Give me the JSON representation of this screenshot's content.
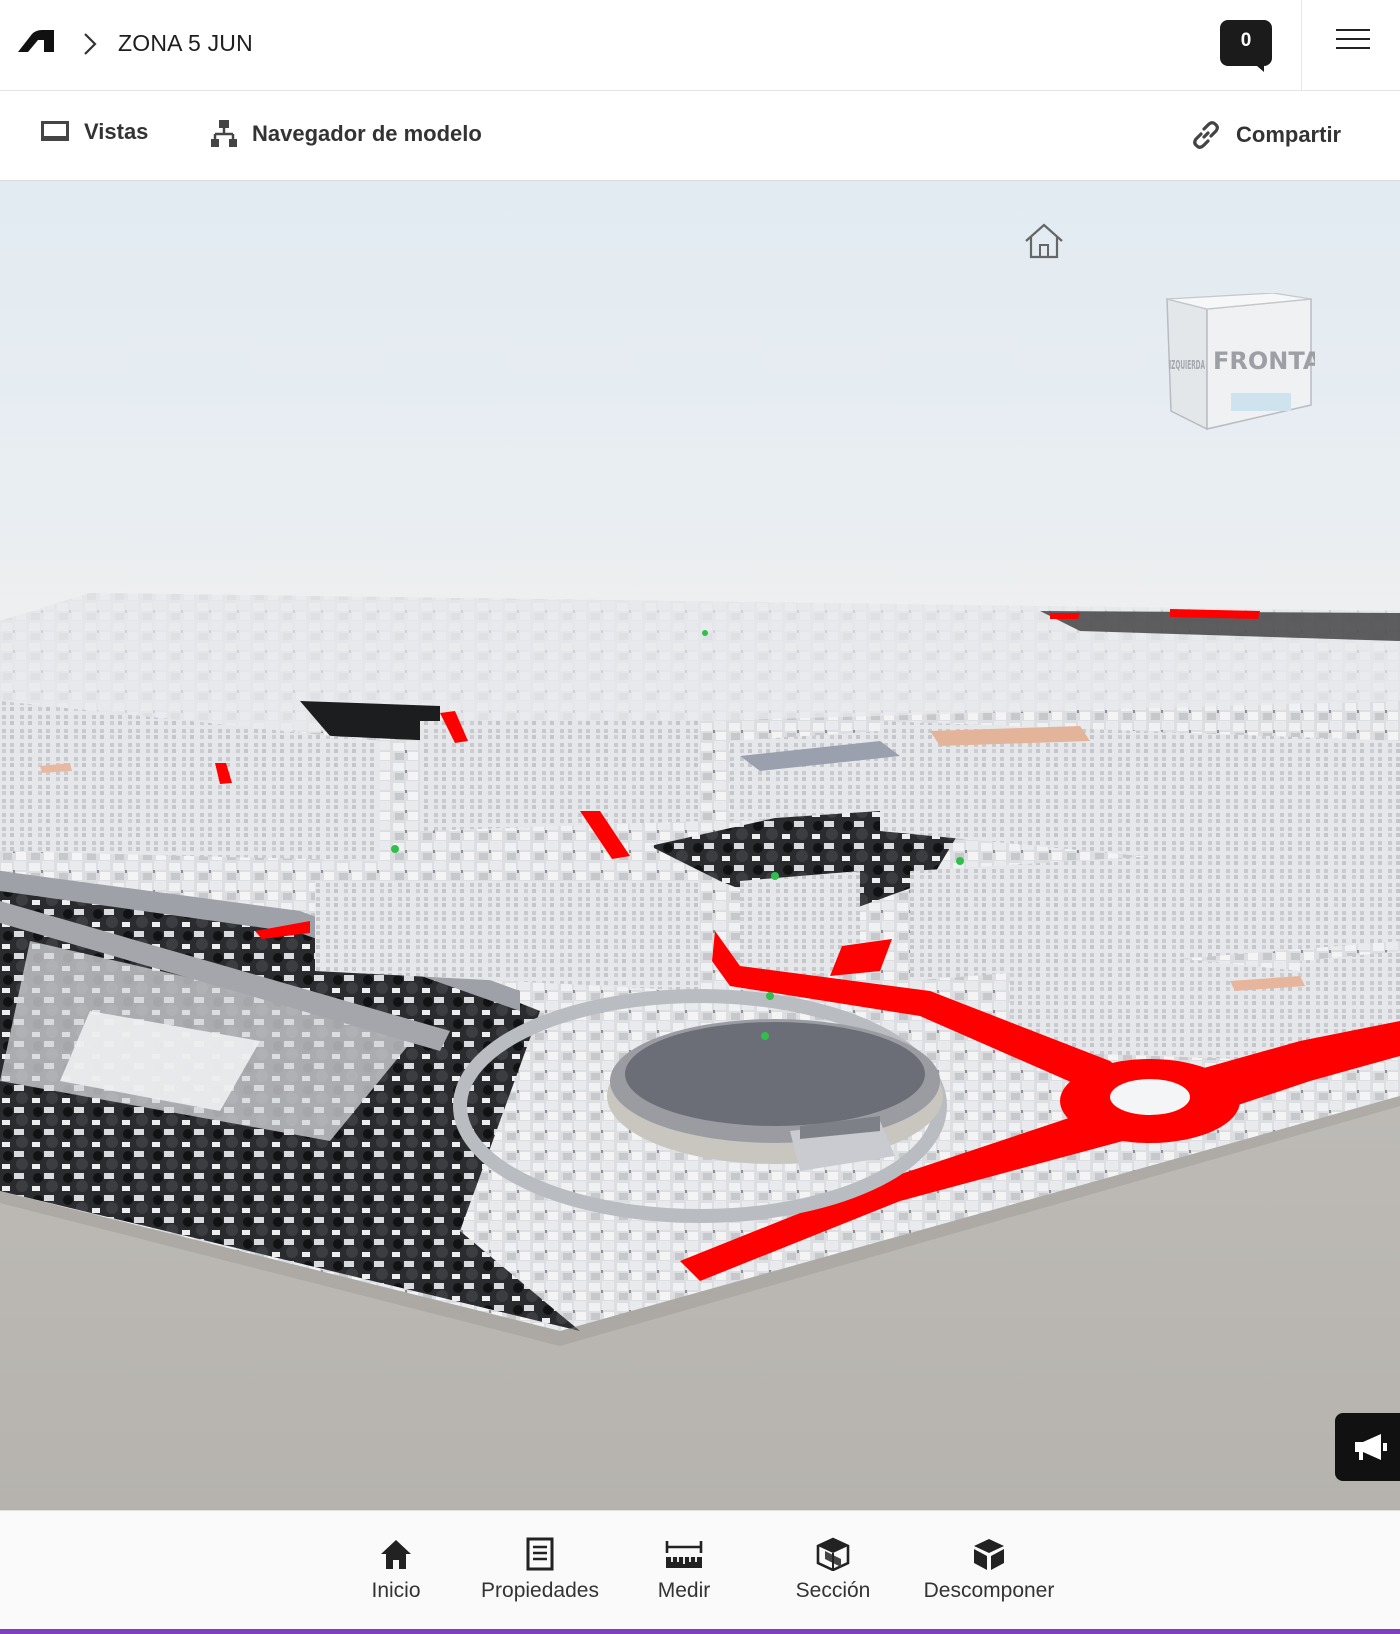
{
  "header": {
    "title": "ZONA 5 JUN",
    "comments_count": "0"
  },
  "toolbar": {
    "views_label": "Vistas",
    "model_browser_label": "Navegador de modelo",
    "share_label": "Compartir"
  },
  "viewer": {
    "viewcube_face": "FRONTAL",
    "viewcube_side_face": "IZQUIERDA"
  },
  "bottom_tools": [
    {
      "label": "Inicio",
      "icon": "home-icon"
    },
    {
      "label": "Propiedades",
      "icon": "properties-icon"
    },
    {
      "label": "Medir",
      "icon": "measure-icon"
    },
    {
      "label": "Sección",
      "icon": "section-icon"
    },
    {
      "label": "Descomponer",
      "icon": "explode-icon"
    }
  ],
  "colors": {
    "highlight": "#ff0000",
    "accent": "#7f3fbf",
    "dark": "#1b1b1b"
  }
}
